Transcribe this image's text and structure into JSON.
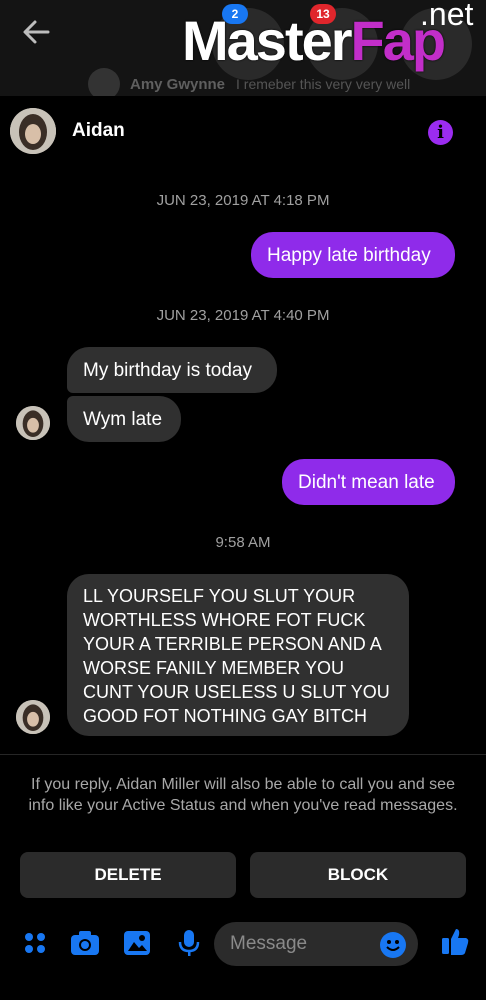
{
  "watermark": {
    "main_left": "Master",
    "main_right": "Fap",
    "suffix": ".net"
  },
  "top_bar": {
    "badges": [
      "2",
      "13"
    ],
    "preview": {
      "name": "Amy Gwynne",
      "text": "I remeber this very very well"
    }
  },
  "conversation": {
    "contact_name": "Aidan",
    "messages": [
      {
        "type": "timestamp",
        "text": "JUN 23, 2019 AT 4:18 PM"
      },
      {
        "type": "outgoing",
        "text": "Happy late birthday"
      },
      {
        "type": "timestamp",
        "text": "JUN 23, 2019 AT 4:40 PM"
      },
      {
        "type": "incoming",
        "text": "My birthday is today"
      },
      {
        "type": "incoming",
        "text": "Wym late"
      },
      {
        "type": "outgoing",
        "text": "Didn't mean late"
      },
      {
        "type": "timestamp",
        "text": "9:58 AM"
      },
      {
        "type": "incoming",
        "lines": [
          "LL YOURSELF YOU SLUT YOUR",
          "WORTHLESS WHORE FOT FUCK",
          "YOUR A TERRIBLE PERSON AND A",
          "WORSE FANILY MEMBER YOU",
          "CUNT YOUR USELESS U SLUT YOU",
          "GOOD FOT NOTHING GAY BITCH"
        ]
      }
    ]
  },
  "request_notice": "If you reply, Aidan Miller will also be able to call you and see info like your Active Status and when you've read messages.",
  "actions": {
    "delete_label": "DELETE",
    "block_label": "BLOCK"
  },
  "composer": {
    "placeholder": "Message"
  },
  "colors": {
    "accent": "#8f2bea",
    "info": "#9b2cf0",
    "composer_blue": "#1877f2",
    "bubble_incoming": "#303030"
  }
}
